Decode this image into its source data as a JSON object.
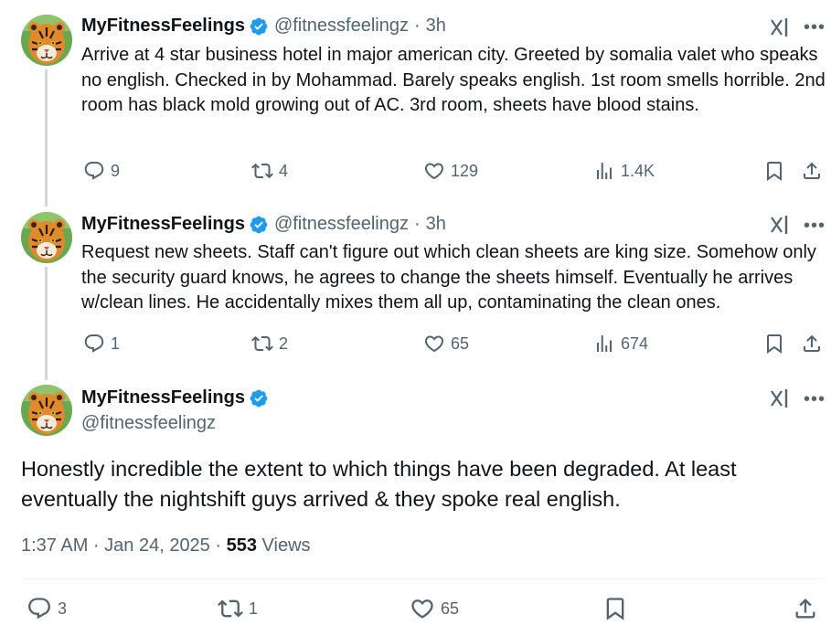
{
  "colors": {
    "verified": "#1d9bf0",
    "text": "#0f1419",
    "secondary": "#536471",
    "thread_line": "#cfd9de"
  },
  "tweets": [
    {
      "name": "MyFitnessFeelings",
      "handle": "@fitnessfeelingz",
      "time": "3h",
      "text": "Arrive at 4 star business hotel in major american city. Greeted by somalia valet who speaks no english. Checked in by Mohammad. Barely speaks english. 1st room smells horrible. 2nd room has black mold growing out of AC. 3rd room, sheets have blood stains.",
      "replies": "9",
      "reposts": "4",
      "likes": "129",
      "views": "1.4K"
    },
    {
      "name": "MyFitnessFeelings",
      "handle": "@fitnessfeelingz",
      "time": "3h",
      "text": "Request new sheets. Staff can't figure out which clean sheets are king size. Somehow only the security guard knows, he agrees to change the sheets himself. Eventually he arrives w/clean lines. He accidentally mixes them all up, contaminating the clean ones.",
      "replies": "1",
      "reposts": "2",
      "likes": "65",
      "views": "674"
    }
  ],
  "main": {
    "name": "MyFitnessFeelings",
    "handle": "@fitnessfeelingz",
    "text": "Honestly incredible the extent to which things have been degraded. At least eventually the nightshift guys arrived & they spoke real english.",
    "timestamp": "1:37 AM · Jan 24, 2025 · ",
    "views_count": "553",
    "views_label": " Views",
    "replies": "3",
    "reposts": "1",
    "likes": "65"
  },
  "icons": {
    "avatar": "tiger-avatar",
    "verified": "verified-badge-icon",
    "grok": "grok-icon",
    "more": "more-icon",
    "reply": "reply-icon",
    "repost": "repost-icon",
    "like": "heart-icon",
    "views": "views-icon",
    "bookmark": "bookmark-icon",
    "share": "share-icon"
  }
}
